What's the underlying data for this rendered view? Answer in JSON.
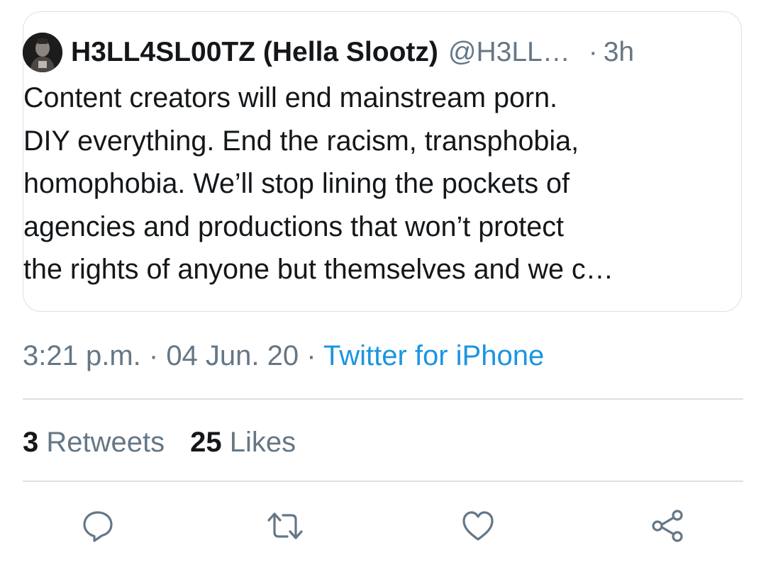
{
  "quoted_tweet": {
    "display_name": "H3LL4SL00TZ (Hella Slootz)",
    "handle": "@H3LL…",
    "separator": "·",
    "time_ago": "3h",
    "text_lines": [
      "Content creators will end mainstream porn.",
      "DIY everything. End the racism, transphobia,",
      "homophobia. We’ll stop lining the pockets of",
      "agencies and productions that won’t protect",
      "the rights of anyone but themselves and we c…"
    ]
  },
  "meta": {
    "time": "3:21 p.m.",
    "sep1": " · ",
    "date": "04 Jun. 20",
    "sep2": " · ",
    "source": "Twitter for iPhone"
  },
  "stats": {
    "retweets_count": "3",
    "retweets_label": "Retweets",
    "likes_count": "25",
    "likes_label": "Likes"
  },
  "actions": {
    "icons": [
      "reply-icon",
      "retweet-icon",
      "like-icon",
      "share-icon"
    ]
  },
  "colors": {
    "text": "#14171a",
    "secondary": "#657786",
    "link": "#1b95e0",
    "border": "#d9e1e8"
  }
}
